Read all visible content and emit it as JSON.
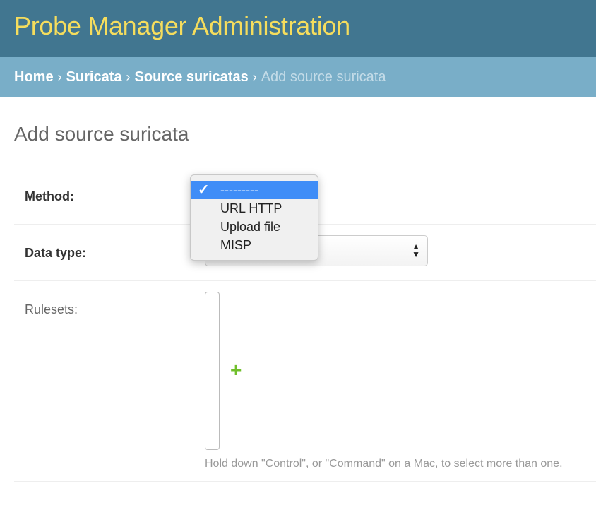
{
  "header": {
    "title": "Probe Manager Administration"
  },
  "breadcrumbs": {
    "items": [
      "Home",
      "Suricata",
      "Source suricatas"
    ],
    "separator": "›",
    "current": "Add source suricata"
  },
  "page": {
    "title": "Add source suricata"
  },
  "form": {
    "method": {
      "label": "Method:",
      "options": [
        "---------",
        "URL HTTP",
        "Upload file",
        "MISP"
      ],
      "selected": "---------"
    },
    "data_type": {
      "label": "Data type:"
    },
    "rulesets": {
      "label": "Rulesets:",
      "add_icon": "+",
      "help": "Hold down \"Control\", or \"Command\" on a Mac, to select more than one."
    }
  },
  "icons": {
    "select_arrows": "select-arrows-icon",
    "check": "checkmark-icon",
    "add": "plus-icon"
  },
  "colors": {
    "header_bg": "#417690",
    "title": "#f5dd5d",
    "breadcrumb_bg": "#79aec8",
    "highlight": "#3f8df7",
    "add_green": "#70bf2b"
  }
}
